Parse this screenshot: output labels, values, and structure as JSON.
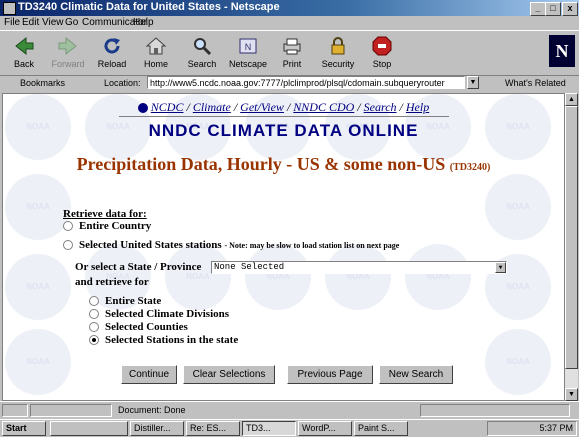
{
  "window": {
    "title": "TD3240 Climatic Data for United States - Netscape",
    "controls": [
      "_",
      "□",
      "x"
    ]
  },
  "menu": [
    "File",
    "Edit",
    "View",
    "Go",
    "Communicator",
    "Help"
  ],
  "toolbar": [
    {
      "label": "Back",
      "icon": "back-arrow-icon",
      "enabled": true
    },
    {
      "label": "Forward",
      "icon": "forward-arrow-icon",
      "enabled": false
    },
    {
      "label": "Reload",
      "icon": "reload-icon",
      "enabled": true
    },
    {
      "label": "Home",
      "icon": "home-icon",
      "enabled": true
    },
    {
      "label": "Search",
      "icon": "search-icon",
      "enabled": true
    },
    {
      "label": "Netscape",
      "icon": "netscape-icon",
      "enabled": true
    },
    {
      "label": "Print",
      "icon": "print-icon",
      "enabled": true
    },
    {
      "label": "Security",
      "icon": "lock-icon",
      "enabled": true
    },
    {
      "label": "Stop",
      "icon": "stop-icon",
      "enabled": true
    }
  ],
  "locationbar": {
    "bookmarks_label": "Bookmarks",
    "location_label": "Location:",
    "url": "http://www5.ncdc.noaa.gov:7777/plclimprod/plsql/cdomain.subqueryrouter",
    "whats_related": "What's Related"
  },
  "page": {
    "nav_links": [
      "NCDC",
      "Climate",
      "Get/View",
      "NNDC CDO",
      "Search",
      "Help"
    ],
    "nav_separator": "/",
    "banner": "NNDC CLIMATE DATA ONLINE",
    "heading": "Precipitation Data, Hourly - US & some non-US",
    "dataset_id": "(TD3240)",
    "retrieve_label": "Retrieve data for:",
    "options": {
      "entire_country": "Entire Country",
      "selected_stations": "Selected United States stations",
      "selected_stations_note": "- Note: may be slow to load station list on next page"
    },
    "state_label": "Or select a State / Province",
    "state_value": "None Selected",
    "retrieve_for_label": "and retrieve for",
    "sub_options": [
      {
        "label": "Entire State",
        "selected": false
      },
      {
        "label": "Selected Climate Divisions",
        "selected": false
      },
      {
        "label": "Selected Counties",
        "selected": false
      },
      {
        "label": "Selected Stations in the state",
        "selected": true
      }
    ],
    "buttons": {
      "continue": "Continue",
      "clear": "Clear Selections",
      "previous": "Previous Page",
      "new_search": "New Search"
    },
    "watermark_text": "NOAA"
  },
  "statusbar": {
    "text": "Document: Done"
  },
  "taskbar": {
    "start": "Start",
    "tasks": [
      {
        "label": "Distiller...",
        "active": false
      },
      {
        "label": "Re: ES...",
        "active": false
      },
      {
        "label": "TD3...",
        "active": true
      },
      {
        "label": "WordP...",
        "active": false
      },
      {
        "label": "Paint S...",
        "active": false
      }
    ],
    "clock": "5:37 PM"
  },
  "colors": {
    "title_bar": "#0a246a",
    "link": "#000080",
    "heading": "#993300",
    "chrome": "#c0c0c0"
  }
}
